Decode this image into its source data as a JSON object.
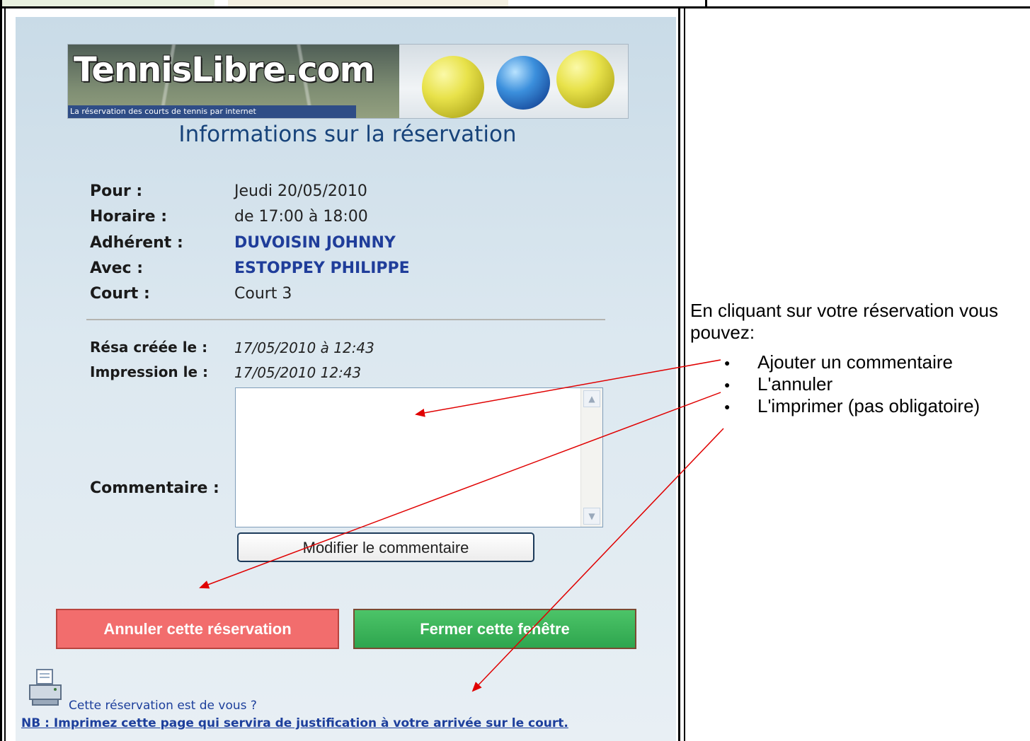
{
  "banner": {
    "logo": "TennisLibre.com",
    "tagline": "La réservation des courts de tennis par internet"
  },
  "dialog": {
    "title": "Informations sur la réservation",
    "fields": {
      "pour_label": "Pour :",
      "pour_value": "Jeudi 20/05/2010",
      "horaire_label": "Horaire :",
      "horaire_value": "de 17:00 à 18:00",
      "adherent_label": "Adhérent :",
      "adherent_value": "DUVOISIN JOHNNY",
      "avec_label": "Avec :",
      "avec_value": "ESTOPPEY PHILIPPE",
      "court_label": "Court :",
      "court_value": "Court 3"
    },
    "meta": {
      "created_label": "Résa créée le :",
      "created_value": "17/05/2010 à 12:43",
      "printed_label": "Impression le :",
      "printed_value": "17/05/2010 12:43"
    },
    "comment_label": "Commentaire :",
    "comment_value": "",
    "modify_button": "Modifier le commentaire",
    "cancel_button": "Annuler cette réservation",
    "close_button": "Fermer cette fenêtre",
    "question": "Cette réservation est de vous ?",
    "nb": "NB : Imprimez cette page qui servira de justification à votre arrivée sur le court.",
    "colors": {
      "cancel": "#f26d6d",
      "close": "#3bb55a",
      "title": "#17437a",
      "link": "#1d3f9c"
    }
  },
  "annotation": {
    "intro": "En cliquant sur votre réservation vous pouvez:",
    "items": [
      "Ajouter un commentaire",
      "L'annuler",
      "L'imprimer (pas obligatoire)"
    ],
    "arrow_color": "#e00000"
  }
}
